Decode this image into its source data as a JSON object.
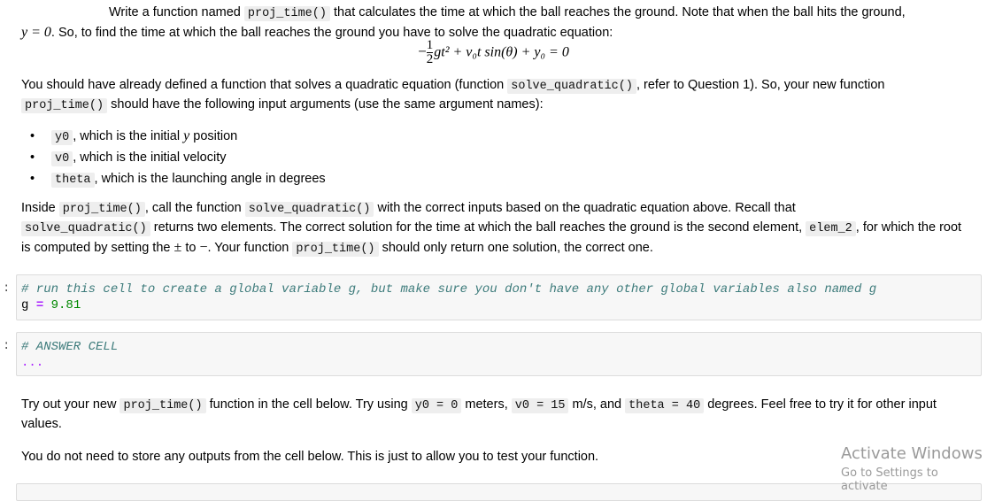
{
  "intro": {
    "line1_pre": "Write a function named",
    "line1_code": "proj_time()",
    "line1_post": "that calculates the time at which the ball reaches the ground. Note that when the ball hits the ground,",
    "line2_math": "y = 0",
    "line2_post": ". So, to find the time at which the ball reaches the ground you have to solve the quadratic equation:"
  },
  "equation": {
    "minus": "−",
    "frac_num": "1",
    "frac_den": "2",
    "body": "gt² + v₀t sin(θ) + y₀ = 0"
  },
  "para2": {
    "pre": "You should have already defined a function that solves a quadratic equation (function",
    "code1": "solve_quadratic()",
    "mid": ", refer to Question 1). So, your new function",
    "code2": "proj_time()",
    "post": "should have the following input arguments (use the same argument names):"
  },
  "args": [
    {
      "code": "y0",
      "text_pre": ", which is the initial ",
      "math": "y",
      "text_post": " position"
    },
    {
      "code": "v0",
      "text_pre": ", which is the initial velocity",
      "math": "",
      "text_post": ""
    },
    {
      "code": "theta",
      "text_pre": ", which is the launching angle in degrees",
      "math": "",
      "text_post": ""
    }
  ],
  "para3": {
    "p1": "Inside",
    "c1": "proj_time()",
    "p2": ", call the function",
    "c2": "solve_quadratic()",
    "p3": "with the correct inputs based on the quadratic equation above. Recall that",
    "c3": "solve_quadratic()",
    "p4": "returns two elements. The correct solution for the time at which the ball reaches the ground is the second element,",
    "c4": "elem_2",
    "p5": ", for which the root is computed by setting the",
    "pm": "±",
    "p6": "to",
    "minus": "−",
    "p7": ". Your function",
    "c5": "proj_time()",
    "p8": "should only return one solution, the correct one."
  },
  "cells": [
    {
      "prompt": ":",
      "comment": "# run this cell to create a global variable g, but make sure you don't have any other global variables also named g",
      "var": "g",
      "op": "=",
      "value": "9.81"
    },
    {
      "prompt": ":",
      "comment": "# ANSWER CELL",
      "ellipsis": "..."
    }
  ],
  "para4": {
    "p1": "Try out your new",
    "c1": "proj_time()",
    "p2": "function in the cell below. Try using",
    "c2": "y0 = 0",
    "p3": "meters,",
    "c3": "v0 = 15",
    "p4": "m/s, and",
    "c4": "theta = 40",
    "p5": "degrees. Feel free to try it for other input values."
  },
  "para5": "You do not need to store any outputs from the cell below. This is just to allow you to test your function.",
  "watermark": {
    "title": "Activate Windows",
    "subtitle": "Go to Settings to activate"
  }
}
